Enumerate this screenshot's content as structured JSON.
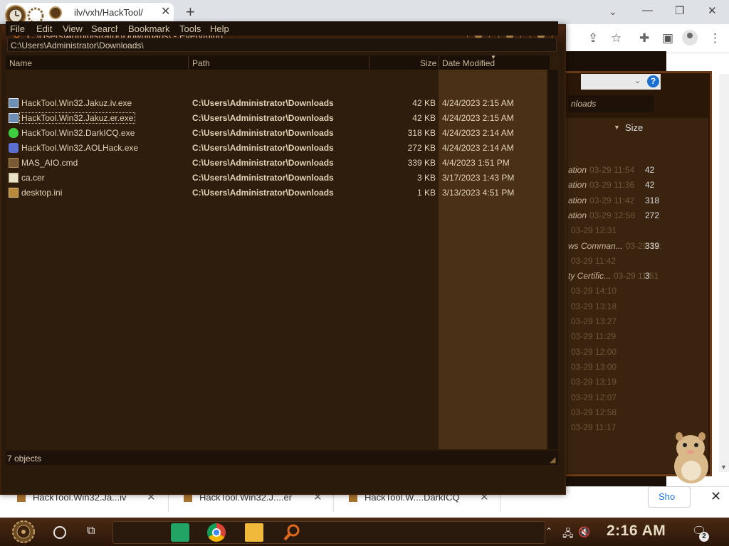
{
  "browser": {
    "tab_title": "ilv/vxh/HackTool/",
    "tab_close": "✕",
    "new_tab": "+",
    "tab_search": "⌄",
    "minimize": "—",
    "restore": "❐",
    "close": "✕",
    "downloads": [
      {
        "name": "HackTool.Win32.Ja...iv",
        "close": "✕"
      },
      {
        "name": "HackTool.Win32.J....er",
        "close": "✕"
      },
      {
        "name": "HackTool.W....DarkICQ",
        "close": "✕"
      }
    ],
    "show_all": "Sho",
    "dl_bar_close": "✕"
  },
  "everything": {
    "title": "C:\\Users\\Administrator\\Downloads\\ - Everything",
    "menu": [
      "File",
      "Edit",
      "View",
      "Search",
      "Bookmark",
      "Tools",
      "Help"
    ],
    "search_value": "C:\\Users\\Administrator\\Downloads\\",
    "columns": {
      "name": "Name",
      "path": "Path",
      "size": "Size",
      "date": "Date Modified"
    },
    "rows": [
      {
        "icon": "exe-icon",
        "name": "HackTool.Win32.Jakuz.iv.exe",
        "path": "C:\\Users\\Administrator\\Downloads",
        "size": "42 KB",
        "date": "4/24/2023 2:15 AM"
      },
      {
        "icon": "exe-icon",
        "name": "HackTool.Win32.Jakuz.er.exe",
        "path": "C:\\Users\\Administrator\\Downloads",
        "size": "42 KB",
        "date": "4/24/2023 2:15 AM"
      },
      {
        "icon": "alien-icon",
        "name": "HackTool.Win32.DarkICQ.exe",
        "path": "C:\\Users\\Administrator\\Downloads",
        "size": "318 KB",
        "date": "4/24/2023 2:14 AM"
      },
      {
        "icon": "aol-icon",
        "name": "HackTool.Win32.AOLHack.exe",
        "path": "C:\\Users\\Administrator\\Downloads",
        "size": "272 KB",
        "date": "4/24/2023 2:14 AM"
      },
      {
        "icon": "cmd-icon",
        "name": "MAS_AIO.cmd",
        "path": "C:\\Users\\Administrator\\Downloads",
        "size": "339 KB",
        "date": "4/4/2023 1:51 PM"
      },
      {
        "icon": "certificate-icon",
        "name": "ca.cer",
        "path": "C:\\Users\\Administrator\\Downloads",
        "size": "3 KB",
        "date": "3/17/2023 1:43 PM"
      },
      {
        "icon": "ini-icon",
        "name": "desktop.ini",
        "path": "C:\\Users\\Administrator\\Downloads",
        "size": "1 KB",
        "date": "3/13/2023 4:51 PM"
      }
    ],
    "status": "7 objects",
    "selected_row": 1
  },
  "background_window": {
    "address": "nloads",
    "column": "Size",
    "help": "?",
    "rows": [
      {
        "type": "ation",
        "date": "03-29 11:54",
        "size": "42"
      },
      {
        "type": "ation",
        "date": "03-29 11:36",
        "size": "42"
      },
      {
        "type": "ation",
        "date": "03-29 11:42",
        "size": "318"
      },
      {
        "type": "ation",
        "date": "03-29 12:58",
        "size": "272"
      },
      {
        "type": "",
        "date": "03-29 12:31",
        "size": ""
      },
      {
        "type": "ws Comman...",
        "date": "03-29 12:13",
        "size": "339"
      },
      {
        "type": "",
        "date": "03-29 11:42",
        "size": ""
      },
      {
        "type": "ty Certific...",
        "date": "03-29 11:51",
        "size": "3"
      },
      {
        "type": "",
        "date": "03-29 14:10",
        "size": ""
      },
      {
        "type": "",
        "date": "03-29 13:18",
        "size": ""
      },
      {
        "type": "",
        "date": "03-29 13:27",
        "size": ""
      },
      {
        "type": "",
        "date": "03-29 11:29",
        "size": ""
      },
      {
        "type": "",
        "date": "03-29 12:00",
        "size": ""
      },
      {
        "type": "",
        "date": "03-29 13:00",
        "size": ""
      },
      {
        "type": "",
        "date": "03-29 13:19",
        "size": ""
      },
      {
        "type": "",
        "date": "03-29 12:07",
        "size": ""
      },
      {
        "type": "",
        "date": "03-29 12:58",
        "size": ""
      },
      {
        "type": "",
        "date": "03-29 11:17",
        "size": ""
      }
    ]
  },
  "taskbar": {
    "clock": "2:16 AM",
    "notifications_count": "2"
  },
  "colors": {
    "window_bg": "#2a1a0c",
    "text": "#e2d3b6",
    "accent": "#e06a1c"
  }
}
